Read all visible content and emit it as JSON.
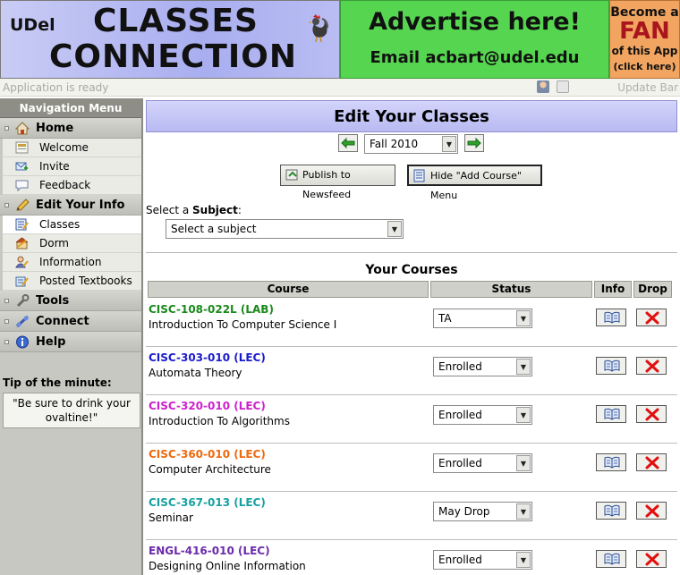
{
  "header": {
    "logo_prefix": "UDel",
    "logo_line1": "CLASSES",
    "logo_line2": "CONNECTION",
    "ad_title": "Advertise here!",
    "ad_contact": "Email acbart@udel.edu",
    "fan_line1": "Become a",
    "fan_line2": "FAN",
    "fan_line3": "of this App",
    "fan_line4": "(click here)"
  },
  "statusbar": {
    "status": "Application is ready",
    "update": "Update Bar"
  },
  "sidebar": {
    "header": "Navigation Menu",
    "groups": [
      {
        "label": "Home",
        "icon": "home-icon",
        "items": [
          {
            "label": "Welcome",
            "icon": "welcome-icon"
          },
          {
            "label": "Invite",
            "icon": "invite-icon"
          },
          {
            "label": "Feedback",
            "icon": "feedback-icon"
          }
        ]
      },
      {
        "label": "Edit Your Info",
        "icon": "pencil-icon",
        "items": [
          {
            "label": "Classes",
            "icon": "classes-icon"
          },
          {
            "label": "Dorm",
            "icon": "dorm-icon"
          },
          {
            "label": "Information",
            "icon": "information-icon"
          },
          {
            "label": "Posted Textbooks",
            "icon": "textbooks-icon"
          }
        ]
      },
      {
        "label": "Tools",
        "icon": "wrench-icon"
      },
      {
        "label": "Connect",
        "icon": "connect-icon"
      },
      {
        "label": "Help",
        "icon": "help-icon"
      }
    ],
    "tip_title": "Tip of the minute:",
    "tip_text": "\"Be sure to drink your ovaltine!\""
  },
  "main": {
    "title": "Edit Your Classes",
    "semester": "Fall 2010",
    "publish_label": "Publish to Newsfeed",
    "hide_label": "Hide \"Add Course\" Menu",
    "subject_prefix": "Select a ",
    "subject_bold": "Subject",
    "subject_suffix": ":",
    "subject_placeholder": "Select a subject",
    "courses_title": "Your Courses",
    "columns": {
      "course": "Course",
      "status": "Status",
      "info": "Info",
      "drop": "Drop"
    },
    "courses": [
      {
        "code": "CISC-108-022L (LAB)",
        "name": "Introduction To Computer Science I",
        "status": "TA",
        "color": "#1a8a1a"
      },
      {
        "code": "CISC-303-010 (LEC)",
        "name": "Automata Theory",
        "status": "Enrolled",
        "color": "#1a1acc"
      },
      {
        "code": "CISC-320-010 (LEC)",
        "name": "Introduction To Algorithms",
        "status": "Enrolled",
        "color": "#cc22cc"
      },
      {
        "code": "CISC-360-010 (LEC)",
        "name": "Computer Architecture",
        "status": "Enrolled",
        "color": "#ee6a10"
      },
      {
        "code": "CISC-367-013 (LEC)",
        "name": "Seminar",
        "status": "May Drop",
        "color": "#18a0a0"
      },
      {
        "code": "ENGL-416-010 (LEC)",
        "name": "Designing Online Information",
        "status": "Enrolled",
        "color": "#6a2aaa"
      }
    ]
  }
}
